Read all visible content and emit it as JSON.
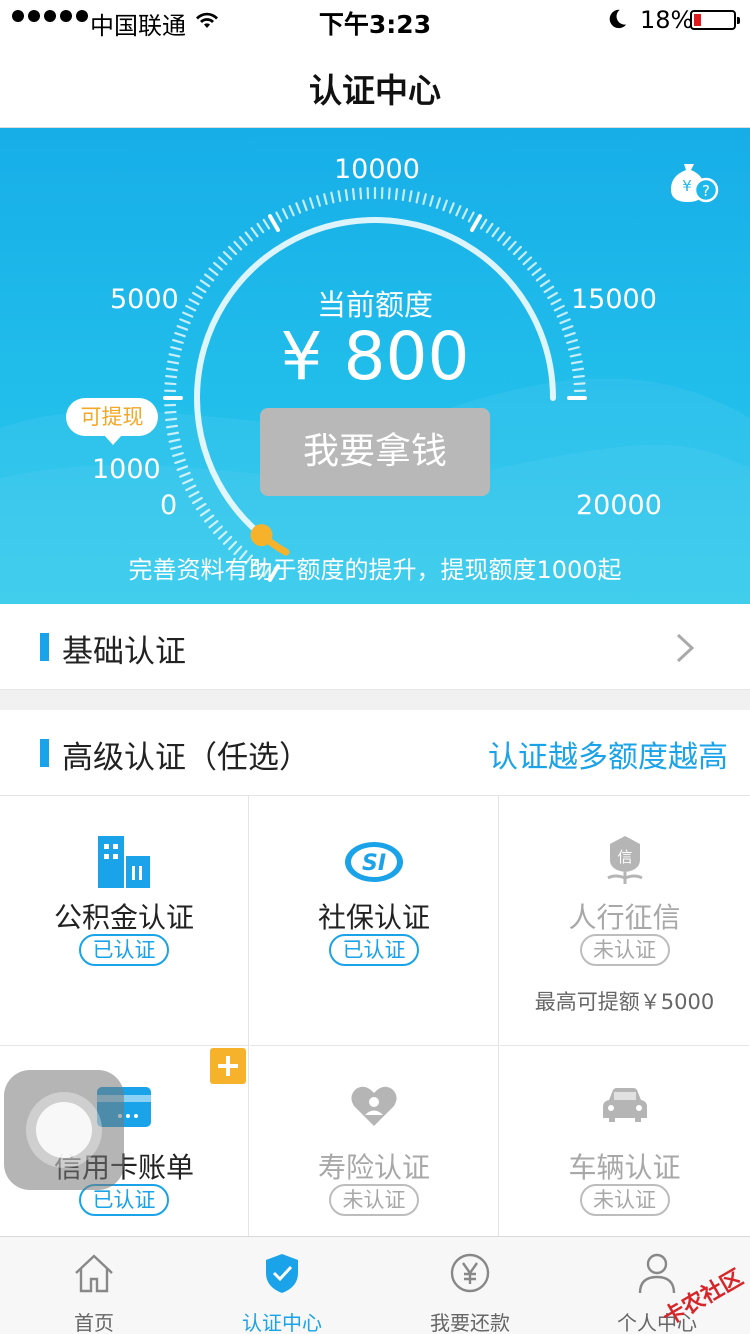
{
  "status_bar": {
    "carrier": "中国联通",
    "time": "下午3:23",
    "battery": "18%",
    "battery_level": 0.18
  },
  "nav": {
    "title": "认证中心"
  },
  "hero": {
    "gauge_ticks": [
      "0",
      "1000",
      "5000",
      "10000",
      "15000",
      "20000"
    ],
    "current_label": "当前额度",
    "amount": "¥ 800",
    "withdraw_button": "我要拿钱",
    "tip_bubble": "可提现",
    "hint": "完善资料有助于额度的提升，提现额度1000起",
    "current_value": 800,
    "help_icon": "money-bag-question-icon"
  },
  "basic": {
    "label": "基础认证"
  },
  "advanced": {
    "label": "高级认证（任选）",
    "slogan": "认证越多额度越高",
    "items": [
      {
        "label": "公积金认证",
        "status": "已认证",
        "verified": true,
        "icon": "building-icon"
      },
      {
        "label": "社保认证",
        "status": "已认证",
        "verified": true,
        "icon": "social-security-icon"
      },
      {
        "label": "人行征信",
        "status": "未认证",
        "verified": false,
        "icon": "credit-flower-icon",
        "note": "最高可提额￥5000"
      },
      {
        "label": "信用卡账单",
        "status": "已认证",
        "verified": true,
        "icon": "credit-card-icon"
      },
      {
        "label": "寿险认证",
        "status": "未认证",
        "verified": false,
        "icon": "heart-person-icon"
      },
      {
        "label": "车辆认证",
        "status": "未认证",
        "verified": false,
        "icon": "car-icon"
      }
    ]
  },
  "tabs": [
    {
      "label": "首页",
      "icon": "home-icon",
      "active": false
    },
    {
      "label": "认证中心",
      "icon": "shield-check-icon",
      "active": true
    },
    {
      "label": "我要还款",
      "icon": "yen-circle-icon",
      "active": false
    },
    {
      "label": "个人中心",
      "icon": "person-icon",
      "active": false
    }
  ],
  "watermark": "卡农社区",
  "colors": {
    "accent": "#1aa3e8",
    "hero": "#1fb8ea",
    "warning": "#f6b22a"
  }
}
